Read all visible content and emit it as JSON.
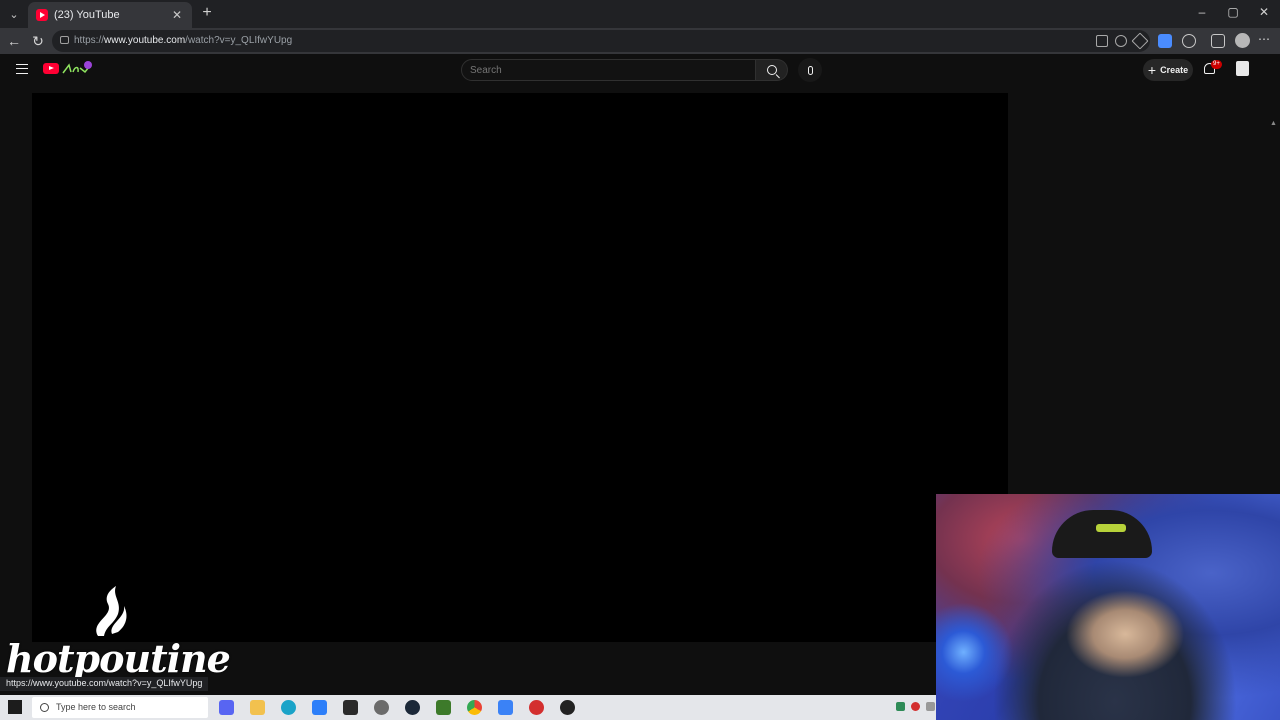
{
  "browser": {
    "tab_title": "(23) YouTube",
    "tab_close": "✕",
    "new_tab": "+",
    "url_prefix": "https://",
    "url_host": "www.youtube.com",
    "url_path": "/watch?v=y_QLIfwYUpg",
    "window_controls": [
      "–",
      "▢",
      "✕"
    ]
  },
  "youtube": {
    "search_placeholder": "Search",
    "create_label": "Create",
    "notification_badge": "9+"
  },
  "overlay": {
    "brand_text": "hotpoutine",
    "status_url": "https://www.youtube.com/watch?v=y_QLIfwYUpg"
  },
  "taskbar": {
    "search_text": "Type here to search",
    "icons": [
      "discord-icon",
      "file-explorer-icon",
      "edge-icon",
      "browser-icon",
      "epic-games-icon",
      "settings-icon",
      "steam-icon",
      "minecraft-icon",
      "chrome-icon",
      "app-icon",
      "record-icon",
      "obs-icon"
    ]
  },
  "colors": {
    "youtube_red": "#ff0033",
    "page_bg": "#0f0f0f",
    "browser_chrome": "#35363a"
  }
}
